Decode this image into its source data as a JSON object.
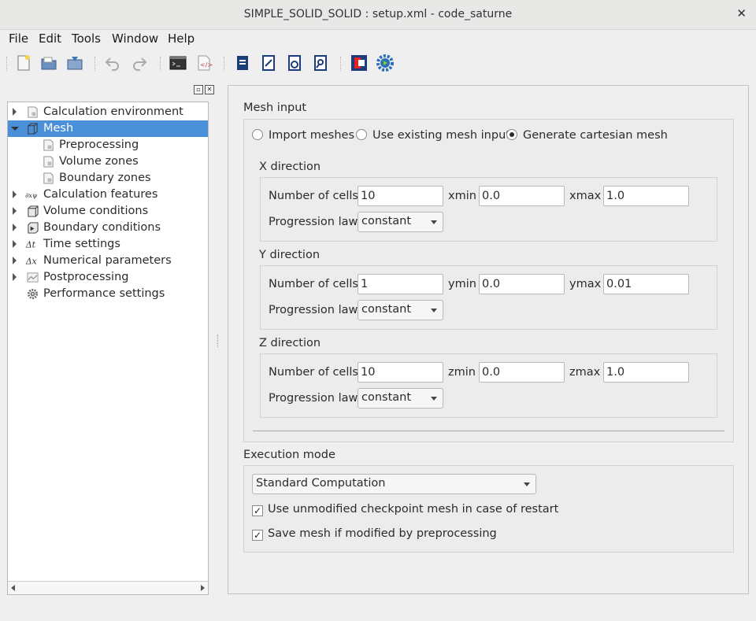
{
  "window": {
    "title": "SIMPLE_SOLID_SOLID : setup.xml - code_saturne"
  },
  "menu": [
    {
      "label": "File"
    },
    {
      "label": "Edit"
    },
    {
      "label": "Tools"
    },
    {
      "label": "Window"
    },
    {
      "label": "Help"
    }
  ],
  "toolbar_icons": [
    "new-file-icon",
    "open-file-icon",
    "save-file-icon",
    "undo-icon",
    "redo-icon",
    "terminal-icon",
    "xml-view-icon",
    "case-summary-icon",
    "edit-case-icon",
    "check-case-icon",
    "search-case-icon",
    "code-saturne-logo-icon",
    "run-gear-icon"
  ],
  "tree": {
    "items": [
      {
        "label": "Calculation environment",
        "icon": "calculation-environment-icon"
      },
      {
        "label": "Mesh",
        "icon": "mesh-icon"
      },
      {
        "label": "Preprocessing",
        "icon": "document-icon"
      },
      {
        "label": "Volume zones",
        "icon": "document-icon"
      },
      {
        "label": "Boundary zones",
        "icon": "document-icon"
      },
      {
        "label": "Calculation features",
        "icon": "equation-icon"
      },
      {
        "label": "Volume conditions",
        "icon": "cube-icon"
      },
      {
        "label": "Boundary conditions",
        "icon": "boundary-icon"
      },
      {
        "label": "Time settings",
        "icon": "delta-t-icon"
      },
      {
        "label": "Numerical parameters",
        "icon": "delta-x-icon"
      },
      {
        "label": "Postprocessing",
        "icon": "chart-icon"
      },
      {
        "label": "Performance settings",
        "icon": "gear-icon"
      }
    ],
    "selected": "Mesh"
  },
  "mesh_input": {
    "title": "Mesh input",
    "options": [
      "Import meshes",
      "Use existing mesh input",
      "Generate cartesian mesh"
    ],
    "selected": "Generate cartesian mesh",
    "directions": [
      {
        "title": "X direction",
        "cells_label": "Number of cells",
        "cells": "10",
        "min_label": "xmin",
        "min": "0.0",
        "max_label": "xmax",
        "max": "1.0",
        "law_label": "Progression law",
        "law": "constant"
      },
      {
        "title": "Y direction",
        "cells_label": "Number of cells",
        "cells": "1",
        "min_label": "ymin",
        "min": "0.0",
        "max_label": "ymax",
        "max": "0.01",
        "law_label": "Progression law",
        "law": "constant"
      },
      {
        "title": "Z direction",
        "cells_label": "Number of cells",
        "cells": "10",
        "min_label": "zmin",
        "min": "0.0",
        "max_label": "zmax",
        "max": "1.0",
        "law_label": "Progression law",
        "law": "constant"
      }
    ]
  },
  "execution": {
    "title": "Execution mode",
    "mode": "Standard Computation",
    "checkbox_checkpoint": "Use unmodified checkpoint mesh in case of restart",
    "checkbox_save": "Save mesh if modified by preprocessing",
    "check_mark": "✓"
  }
}
